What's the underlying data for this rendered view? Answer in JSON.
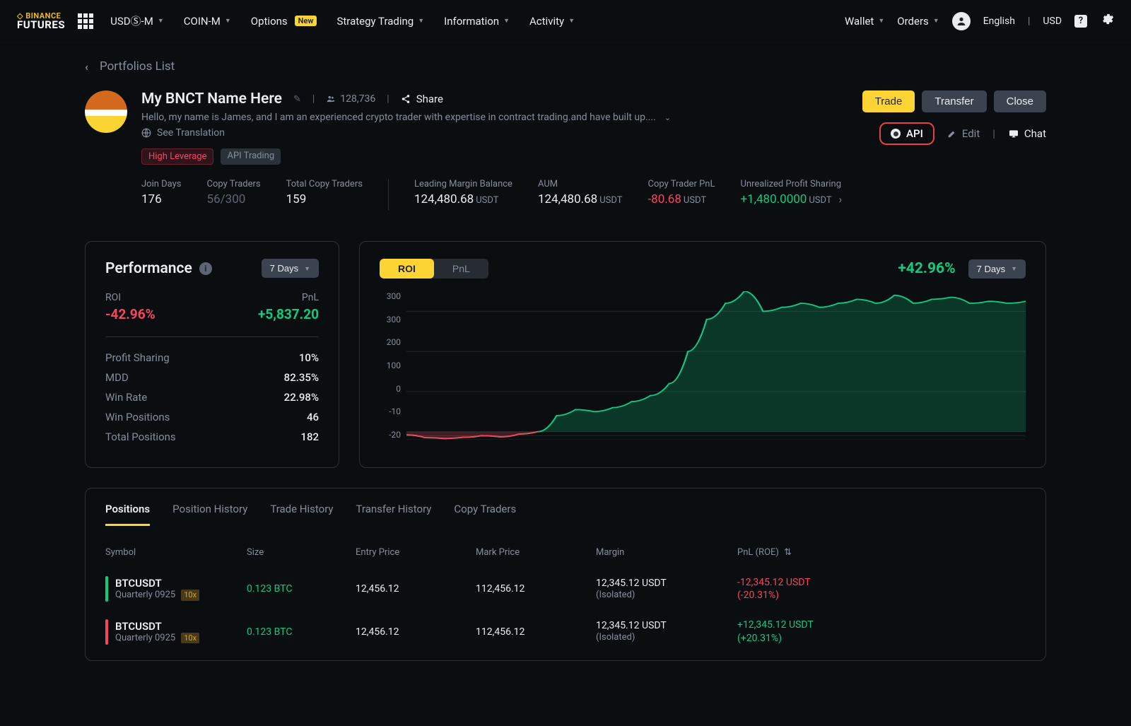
{
  "nav": {
    "logo_top": "◇ BINANCE",
    "logo_bottom": "FUTURES",
    "items": [
      "USDⓈ-M",
      "COIN-M"
    ],
    "options": "Options",
    "options_badge": "New",
    "items2": [
      "Strategy Trading",
      "Information",
      "Activity"
    ],
    "right": [
      "Wallet",
      "Orders"
    ],
    "lang": "English",
    "currency": "USD"
  },
  "breadcrumb": {
    "label": "Portfolios List"
  },
  "header": {
    "title": "My BNCT Name Here",
    "followers": "128,736",
    "share": "Share",
    "desc": "Hello, my name is James, and I am an experienced crypto trader with expertise in contract trading.and have built up....",
    "translate": "See Translation",
    "tags": {
      "high_lev": "High Leverage",
      "api": "API Trading"
    },
    "btn_trade": "Trade",
    "btn_transfer": "Transfer",
    "btn_close": "Close",
    "link_api": "API",
    "link_edit": "Edit",
    "link_chat": "Chat"
  },
  "stats": {
    "join_days": {
      "label": "Join Days",
      "value": "176"
    },
    "copy_traders": {
      "label": "Copy Traders",
      "value": "56/300"
    },
    "total_copy": {
      "label": "Total Copy Traders",
      "value": "159"
    },
    "margin_bal": {
      "label": "Leading Margin Balance",
      "value": "124,480.68",
      "unit": "USDT"
    },
    "aum": {
      "label": "AUM",
      "value": "124,480.68",
      "unit": "USDT"
    },
    "copy_pnl": {
      "label": "Copy Trader PnL",
      "value": "-80.68",
      "unit": "USDT"
    },
    "unreal": {
      "label": "Unrealized Profit Sharing",
      "value": "+1,480.0000",
      "unit": "USDT"
    }
  },
  "perf": {
    "title": "Performance",
    "period": "7 Days",
    "roi": {
      "label": "ROI",
      "value": "-42.96%"
    },
    "pnl": {
      "label": "PnL",
      "value": "+5,837.20"
    },
    "rows": [
      {
        "k": "Profit Sharing",
        "v": "10%"
      },
      {
        "k": "MDD",
        "v": "82.35%"
      },
      {
        "k": "Win Rate",
        "v": "22.98%"
      },
      {
        "k": "Win Positions",
        "v": "46"
      },
      {
        "k": "Total Positions",
        "v": "182"
      }
    ]
  },
  "chart": {
    "seg": [
      "ROI",
      "PnL"
    ],
    "value": "+42.96%",
    "period": "7 Days"
  },
  "chart_data": {
    "type": "area",
    "ylim": [
      -20,
      350
    ],
    "yticks": [
      300,
      300,
      200,
      100,
      0,
      -10,
      -20
    ],
    "series": [
      {
        "name": "ROI",
        "y": [
          -8,
          -15,
          -17,
          -14,
          -10,
          -13,
          -6,
          0,
          40,
          55,
          50,
          60,
          75,
          90,
          120,
          200,
          280,
          320,
          350,
          300,
          310,
          320,
          310,
          320,
          330,
          320,
          340,
          320,
          330,
          335,
          320,
          325,
          320,
          325
        ]
      }
    ]
  },
  "tabs": {
    "list": [
      "Positions",
      "Position History",
      "Trade History",
      "Transfer History",
      "Copy Traders"
    ]
  },
  "table": {
    "headers": [
      "Symbol",
      "Size",
      "Entry Price",
      "Mark Price",
      "Margin",
      "PnL (ROE) "
    ],
    "rows": [
      {
        "side": "long",
        "symbol": "BTCUSDT",
        "sub": "Quarterly 0925",
        "lev": "10x",
        "size": "0.123 BTC",
        "entry": "12,456.12",
        "mark": "112,456.12",
        "margin": "12,345.12 USDT",
        "margin_sub": "(Isolated)",
        "pnl": "-12,345.12 USDT",
        "roe": "(-20.31%)",
        "pnl_dir": "down"
      },
      {
        "side": "short",
        "symbol": "BTCUSDT",
        "sub": "Quarterly 0925",
        "lev": "10x",
        "size": "0.123 BTC",
        "entry": "12,456.12",
        "mark": "112,456.12",
        "margin": "12,345.12 USDT",
        "margin_sub": "(Isolated)",
        "pnl": "+12,345.12 USDT",
        "roe": "(+20.31%)",
        "pnl_dir": "up"
      }
    ]
  }
}
